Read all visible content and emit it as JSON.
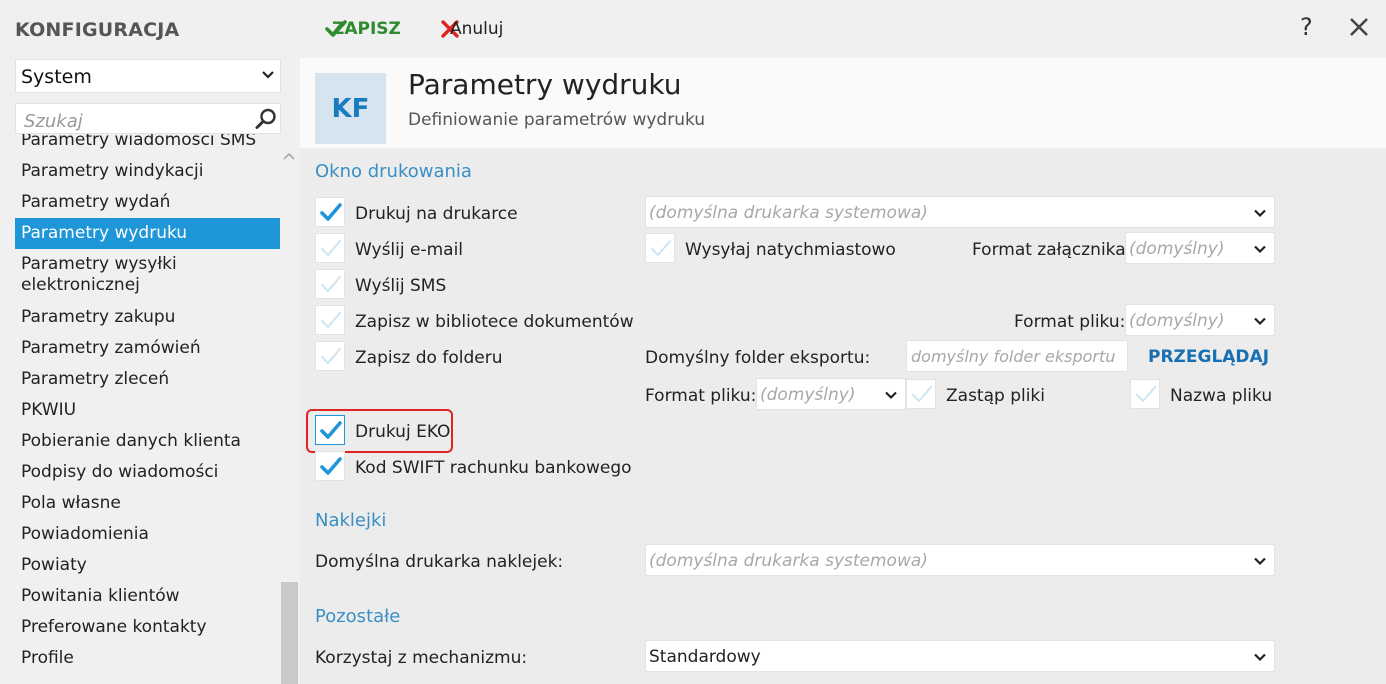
{
  "sidebar": {
    "title": "KONFIGURACJA",
    "category": "System",
    "search_placeholder": "Szukaj",
    "items": [
      "Parametry wiadomości SMS",
      "Parametry windykacji",
      "Parametry wydań",
      "Parametry wydruku",
      "Parametry wysyłki elektronicznej",
      "Parametry zakupu",
      "Parametry zamówień",
      "Parametry zleceń",
      "PKWIU",
      "Pobieranie danych klienta",
      "Podpisy do wiadomości",
      "Pola własne",
      "Powiadomienia",
      "Powiaty",
      "Powitania klientów",
      "Preferowane kontakty",
      "Profile"
    ],
    "active_item": "Parametry wydruku"
  },
  "toolbar": {
    "save_label": "ZAPISZ",
    "cancel_label": "Anuluj",
    "help_label": "?",
    "icons": {
      "save": "checkmark-icon",
      "cancel": "x-icon",
      "close": "close-icon"
    }
  },
  "header": {
    "badge": "KF",
    "title": "Parametry wydruku",
    "subtitle": "Definiowanie parametrów wydruku"
  },
  "print_window": {
    "section_title": "Okno drukowania",
    "print_on_printer": {
      "label": "Drukuj na drukarce",
      "checked": true,
      "printer_placeholder": "(domyślna drukarka systemowa)"
    },
    "send_email": {
      "label": "Wyślij e-mail",
      "checked": false
    },
    "send_immediately": {
      "label": "Wysyłaj natychmiastowo",
      "checked": false
    },
    "attachment_format": {
      "label": "Format załącznika:",
      "placeholder": "(domyślny)"
    },
    "send_sms": {
      "label": "Wyślij SMS",
      "checked": false
    },
    "save_library": {
      "label": "Zapisz w bibliotece dokumentów",
      "checked": false
    },
    "file_format_1": {
      "label": "Format pliku:",
      "placeholder": "(domyślny)"
    },
    "save_folder": {
      "label": "Zapisz do folderu",
      "checked": false
    },
    "export_folder": {
      "label": "Domyślny folder eksportu:",
      "placeholder": "domyślny folder eksportu",
      "browse_label": "PRZEGLĄDAJ"
    },
    "file_format_2": {
      "label": "Format pliku:",
      "placeholder": "(domyślny)"
    },
    "replace_files": {
      "label": "Zastąp pliki",
      "checked": false
    },
    "file_name": {
      "label": "Nazwa pliku",
      "checked": false
    },
    "print_eko": {
      "label": "Drukuj EKO",
      "checked": true
    },
    "swift_code": {
      "label": "Kod SWIFT rachunku bankowego",
      "checked": true
    }
  },
  "labels_section": {
    "section_title": "Naklejki",
    "default_label_printer": {
      "label": "Domyślna drukarka naklejek:",
      "placeholder": "(domyślna drukarka systemowa)"
    }
  },
  "other_section": {
    "section_title": "Pozostałe",
    "mechanism": {
      "label": "Korzystaj z mechanizmu:",
      "value": "Standardowy"
    }
  },
  "colors": {
    "accent": "#1e96d8",
    "section_title": "#3a8fc4",
    "save_green": "#2e8b2e",
    "cancel_red": "#e02424",
    "highlight_border": "#e02424",
    "checkmark_on": "#1e96d8",
    "checkmark_off": "#cfe4f2"
  }
}
